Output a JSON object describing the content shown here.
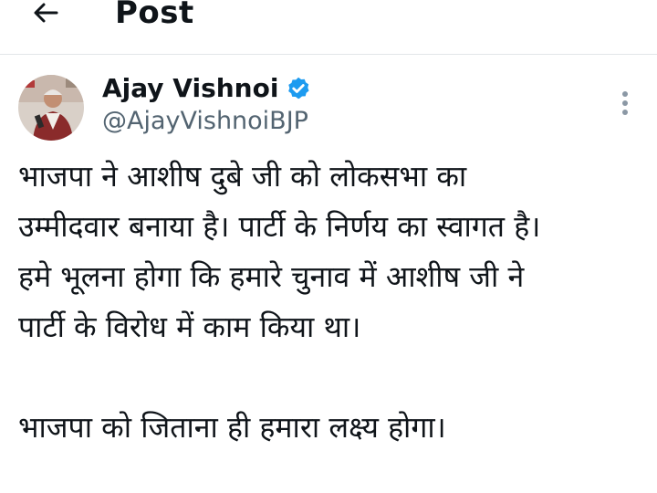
{
  "header": {
    "title": "Post",
    "back_icon": "arrow-left-icon"
  },
  "author": {
    "name": "Ajay Vishnoi",
    "handle": "@AjayVishnoiBJP",
    "verified": true,
    "verified_color": "#1d9bf0"
  },
  "tweet": {
    "lines": [
      "भाजपा ने आशीष दुबे जी को लोकसभा का",
      "उम्मीदवार बनाया है। पार्टी के निर्णय का स्वागत है।",
      "हमे भूलना होगा कि हमारे चुनाव में आशीष जी ने",
      "पार्टी के विरोध में काम किया था।",
      "भाजपा को जिताना ही हमारा लक्ष्य होगा।"
    ]
  },
  "icons": {
    "more": "more-vertical-icon",
    "verified": "verified-badge-icon"
  }
}
